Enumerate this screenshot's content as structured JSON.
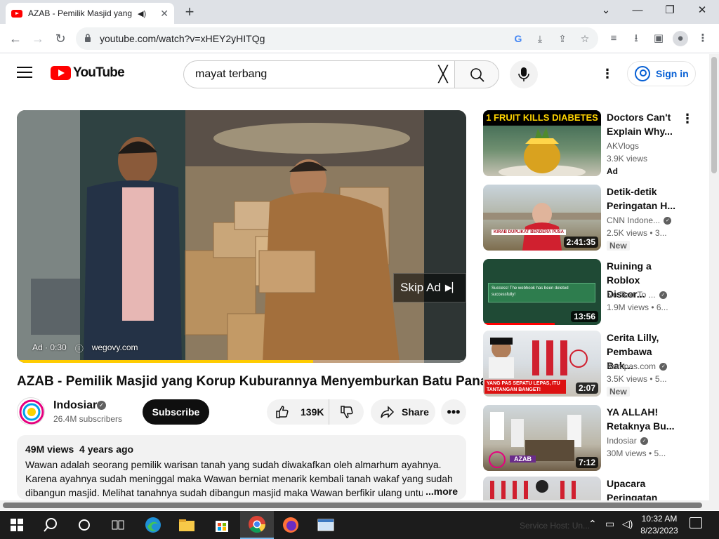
{
  "browser": {
    "tab_title": "AZAB - Pemilik Masjid yang K",
    "url": "youtube.com/watch?v=xHEY2yHITQg",
    "google_badge": "G"
  },
  "header": {
    "logo_text": "YouTube",
    "search_value": "mayat terbang",
    "signin_label": "Sign in"
  },
  "player": {
    "skip_label": "Skip Ad",
    "ad_label": "Ad · 0:30",
    "ad_domain": "wegovy.com",
    "progress": 0.66,
    "progress_color": "#ffcc00"
  },
  "video": {
    "title": "AZAB - Pemilik Masjid yang Korup Kuburannya Menyemburkan Batu Panas",
    "channel": "Indosiar",
    "subscribers": "26.4M subscribers",
    "subscribe_label": "Subscribe",
    "likes": "139K",
    "share_label": "Share",
    "views": "49M views",
    "age": "4 years ago",
    "description": "Wawan adalah seorang pemilik warisan tanah yang sudah diwakafkan oleh almarhum ayahnya. Karena ayahnya sudah meninggal maka Wawan berniat menarik kembali tanah wakaf yang sudah dibangun masjid. Melihat tanahnya sudah dibangun masjid maka Wawan berfikir ulang untu",
    "more_label": "...more"
  },
  "recommendations": [
    {
      "title": "Doctors Can't Explain Why...",
      "channel": "AKVlogs",
      "meta": "3.9K views",
      "badge": "Ad",
      "duration": "",
      "thumb_text": "1 FRUIT KILLS DIABETES",
      "verified": false
    },
    {
      "title": "Detik-detik Peringatan H...",
      "channel": "CNN Indone...",
      "meta": "2.5K views • 3...",
      "badge": "New",
      "duration": "2:41:35",
      "thumb_text": "KIRAB DUPLIKAT BENDERA PUSA",
      "verified": true
    },
    {
      "title": "Ruining a Roblox Discor...",
      "channel": "No Text To ...",
      "meta": "1.9M views • 6...",
      "badge": "",
      "duration": "13:56",
      "thumb_text": "Success! The webhook has been deleted successfully!",
      "verified": true
    },
    {
      "title": "Cerita Lilly, Pembawa Bak...",
      "channel": "Kompas.com",
      "meta": "3.5K views • 5...",
      "badge": "New",
      "duration": "2:07",
      "thumb_text": "YANG PAS SEPATU LEPAS, ITU TANTANGAN BANGET!",
      "verified": true
    },
    {
      "title": "YA ALLAH! Retaknya Bu...",
      "channel": "Indosiar",
      "meta": "30M views • 5...",
      "badge": "",
      "duration": "7:12",
      "thumb_text": "AZAB",
      "verified": true
    },
    {
      "title": "Upacara Peringatan",
      "channel": "",
      "meta": "",
      "badge": "",
      "duration": "",
      "thumb_text": "",
      "verified": false
    }
  ],
  "taskbar": {
    "time": "10:32 AM",
    "date": "8/23/2023",
    "service_text": "Service Host: Un..."
  },
  "colors": {
    "brand_red": "#ff0000",
    "link_blue": "#065fd4",
    "chrome_blue_edge": "#0c59a4"
  }
}
